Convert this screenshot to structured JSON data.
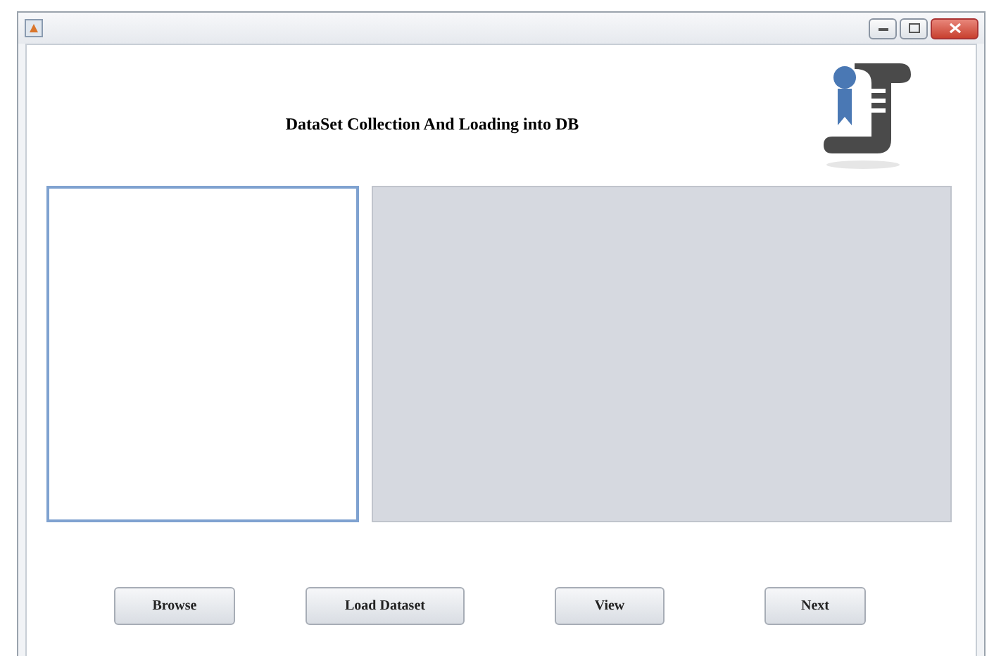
{
  "header": {
    "title": "DataSet Collection And Loading into DB"
  },
  "text_area": {
    "focused": true
  },
  "buttons": [
    {
      "label": "Browse"
    },
    {
      "label": "Load Dataset"
    },
    {
      "label": "View"
    },
    {
      "label": "Next"
    }
  ]
}
